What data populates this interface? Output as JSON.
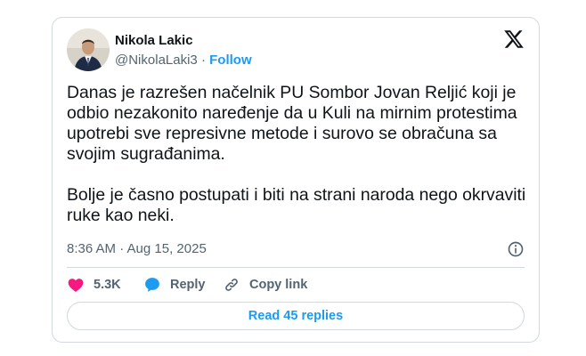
{
  "author": {
    "name": "Nikola Lakic",
    "handle": "@NikolaLaki3",
    "separator": "·",
    "follow_label": "Follow"
  },
  "tweet": {
    "paragraphs": [
      "Danas je razrešen načelnik PU Sombor Jovan Reljić koji je odbio nezakonito naređenje da u Kuli na mirnim protestima upotrebi sve represivne metode i surovo se obračuna sa svojim sugrađanima.",
      "Bolje je časno postupati i biti na strani naroda nego okrvaviti ruke kao neki."
    ],
    "timestamp": "8:36 AM · Aug 15, 2025"
  },
  "actions": {
    "likes": "5.3K",
    "reply_label": "Reply",
    "copy_link_label": "Copy link"
  },
  "read_replies_label": "Read 45 replies",
  "icons": {
    "logo": "x-logo-icon",
    "info": "info-icon",
    "like": "heart-icon",
    "reply": "reply-bubble-icon",
    "copy_link": "link-icon"
  },
  "colors": {
    "accent": "#1d9bf0",
    "like": "#f91880",
    "text": "#0f1419",
    "muted": "#536471",
    "border": "#cfd9de"
  }
}
